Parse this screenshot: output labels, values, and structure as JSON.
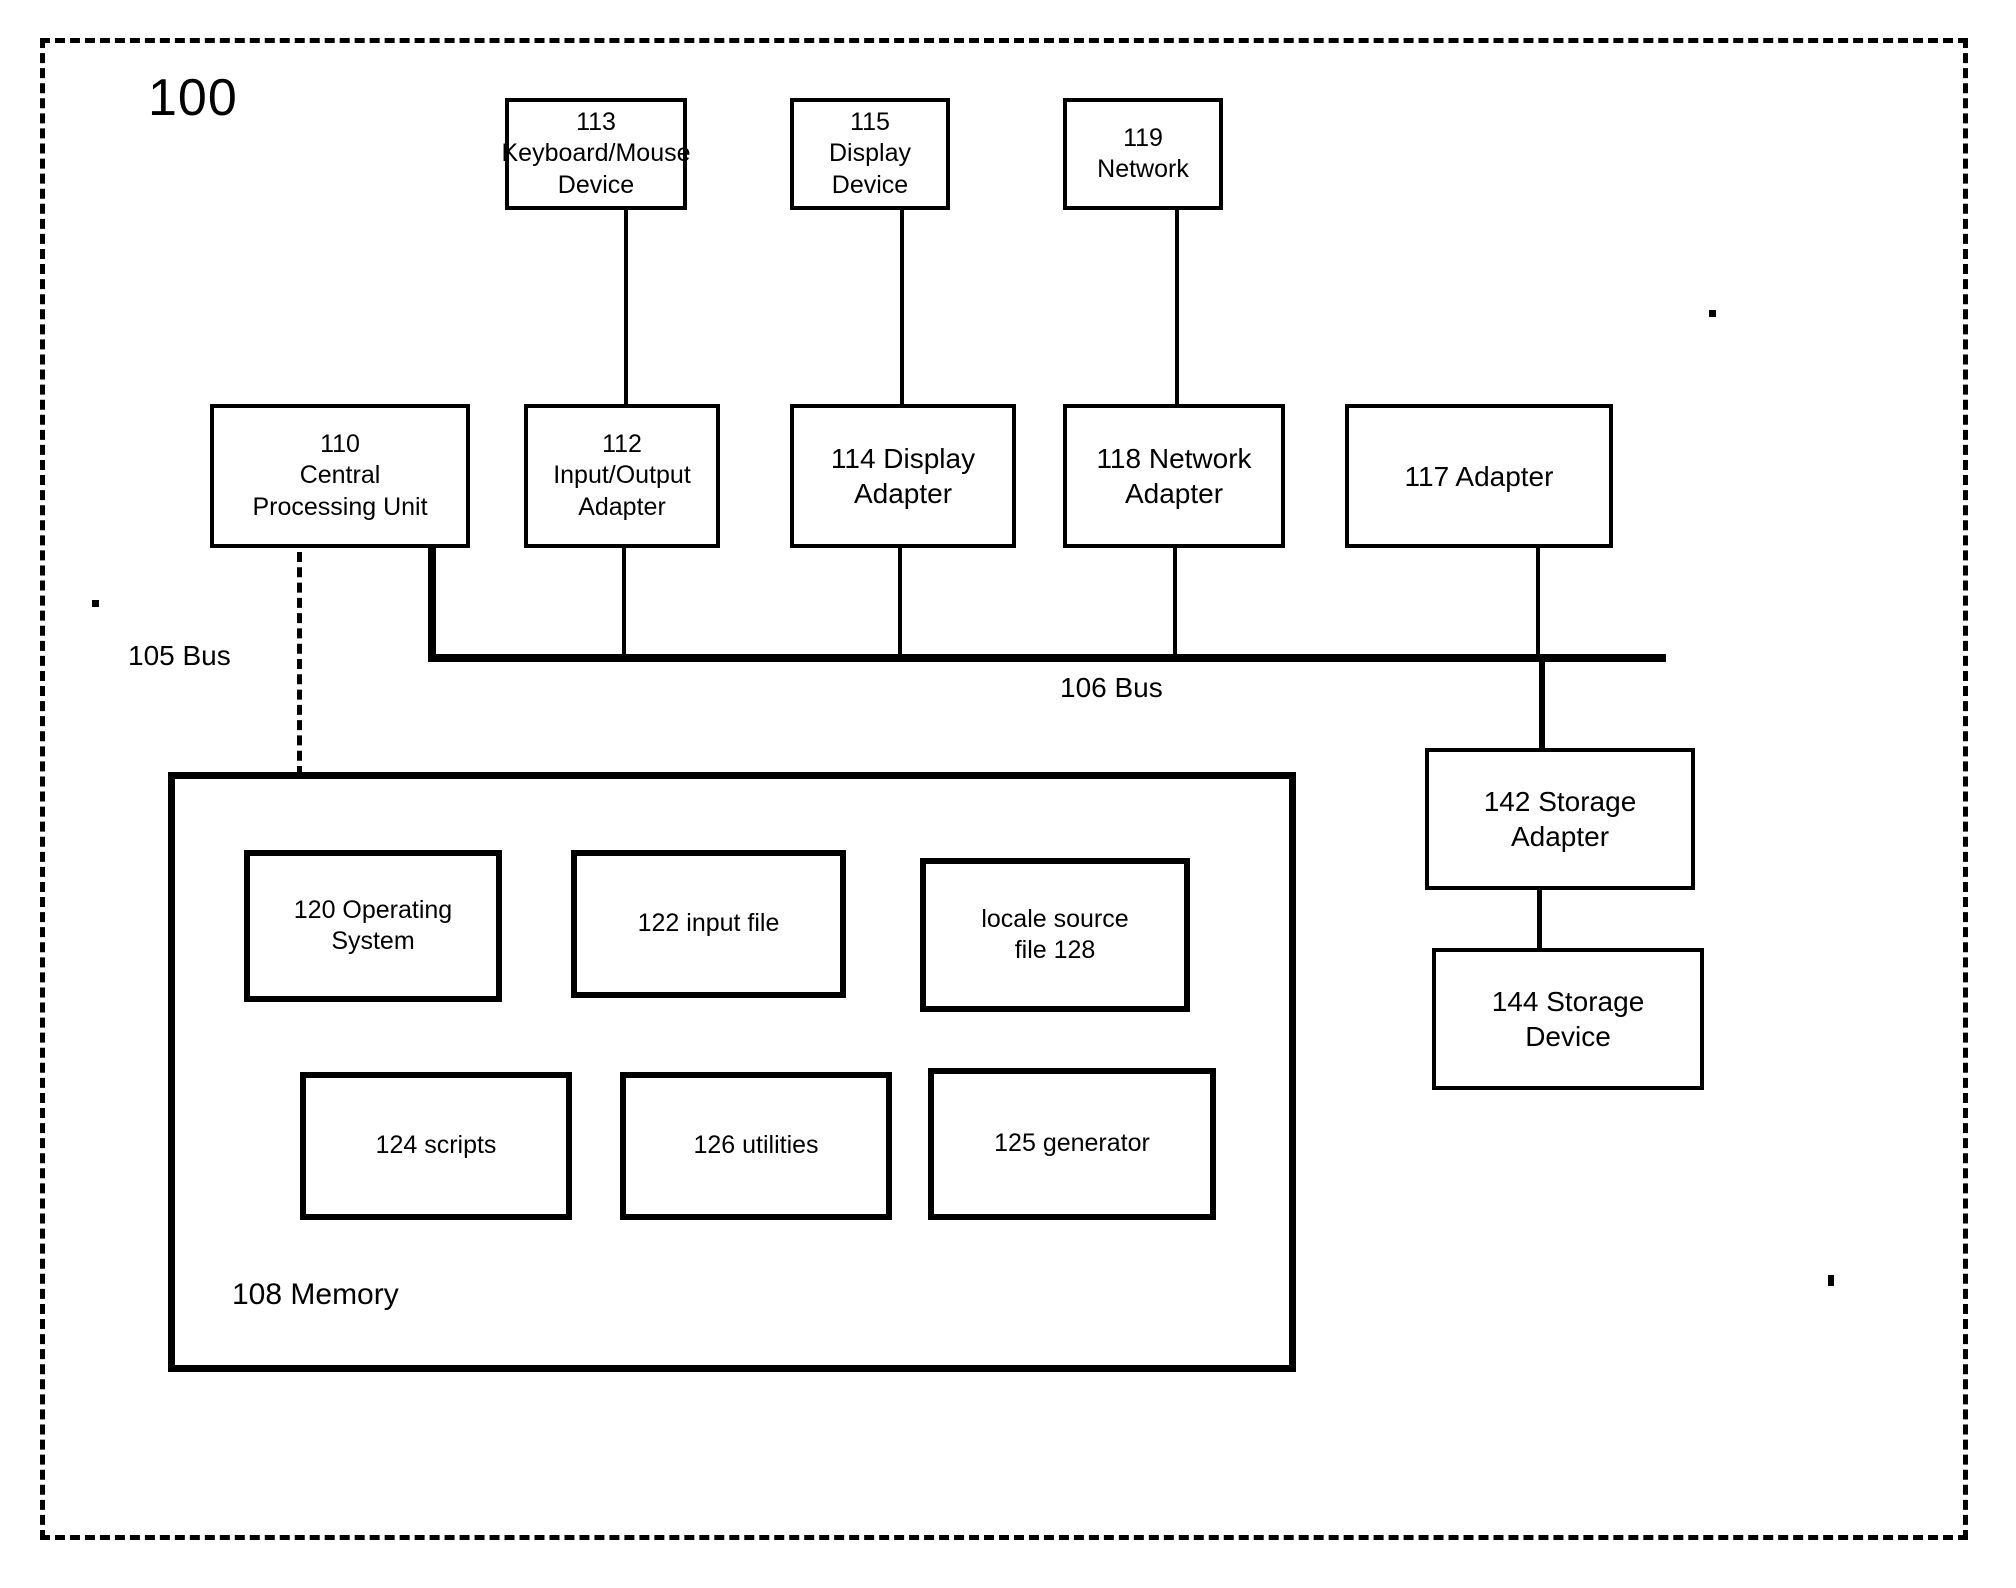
{
  "figure": {
    "number": "100"
  },
  "devices": {
    "keyboard_mouse": "113\nKeyboard/Mouse\nDevice",
    "display_device": "115\nDisplay\nDevice",
    "network": "119\nNetwork"
  },
  "adapters": {
    "cpu": "110\nCentral\nProcessing Unit",
    "io_adapter": "112\nInput/Output\nAdapter",
    "display_adapter": "114 Display\nAdapter",
    "network_adapter": "118 Network\nAdapter",
    "adapter_117": "117 Adapter"
  },
  "buses": {
    "bus_105": "105 Bus",
    "bus_106": "106 Bus"
  },
  "memory": {
    "title": "108 Memory",
    "components": [
      "120 Operating\nSystem",
      "122 input file",
      "locale source\nfile 128",
      "124 scripts",
      "126 utilities",
      "125 generator"
    ]
  },
  "storage": {
    "storage_adapter": "142 Storage\nAdapter",
    "storage_device": "144 Storage\nDevice"
  },
  "colors": {
    "ink": "#000000",
    "paper": "#ffffff"
  }
}
